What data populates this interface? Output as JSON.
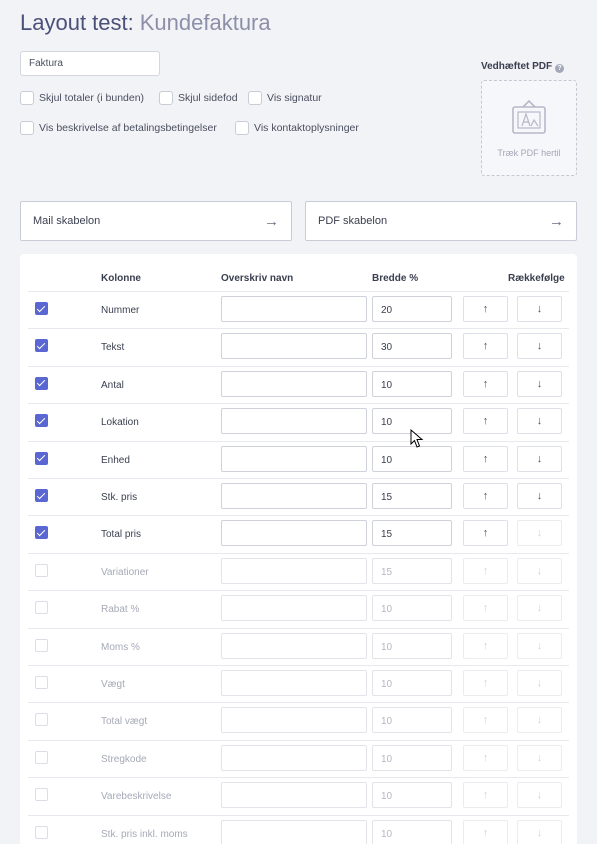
{
  "header": {
    "title": "Layout test:",
    "subtitle": "Kundefaktura"
  },
  "name_field": {
    "value": "Faktura"
  },
  "options": [
    {
      "label": "Skjul totaler (i bunden)",
      "checked": false
    },
    {
      "label": "Skjul sidefod",
      "checked": false
    },
    {
      "label": "Vis signatur",
      "checked": false
    },
    {
      "label": "Vis beskrivelse af betalingsbetingelser",
      "checked": false
    },
    {
      "label": "Vis kontaktoplysninger",
      "checked": false
    }
  ],
  "attachment": {
    "label": "Vedhæftet PDF",
    "help": "?",
    "drop_text": "Træk PDF hertil"
  },
  "templates": {
    "mail": "Mail skabelon",
    "pdf": "PDF skabelon",
    "arrow": "→"
  },
  "table": {
    "headers": {
      "column": "Kolonne",
      "override": "Overskriv navn",
      "width": "Bredde %",
      "order": "Rækkefølge"
    },
    "up_glyph": "↑",
    "down_glyph": "↓",
    "rows": [
      {
        "label": "Nummer",
        "enabled": true,
        "width": "20"
      },
      {
        "label": "Tekst",
        "enabled": true,
        "width": "30"
      },
      {
        "label": "Antal",
        "enabled": true,
        "width": "10"
      },
      {
        "label": "Lokation",
        "enabled": true,
        "width": "10"
      },
      {
        "label": "Enhed",
        "enabled": true,
        "width": "10"
      },
      {
        "label": "Stk. pris",
        "enabled": true,
        "width": "15"
      },
      {
        "label": "Total pris",
        "enabled": true,
        "width": "15"
      },
      {
        "label": "Variationer",
        "enabled": false,
        "width": "15"
      },
      {
        "label": "Rabat %",
        "enabled": false,
        "width": "10"
      },
      {
        "label": "Moms %",
        "enabled": false,
        "width": "10"
      },
      {
        "label": "Vægt",
        "enabled": false,
        "width": "10"
      },
      {
        "label": "Total vægt",
        "enabled": false,
        "width": "10"
      },
      {
        "label": "Stregkode",
        "enabled": false,
        "width": "10"
      },
      {
        "label": "Varebeskrivelse",
        "enabled": false,
        "width": "10"
      },
      {
        "label": "Stk. pris inkl. moms",
        "enabled": false,
        "width": "10"
      }
    ]
  },
  "colors": {
    "accent": "#5a66d1",
    "title": "#4b5079"
  }
}
